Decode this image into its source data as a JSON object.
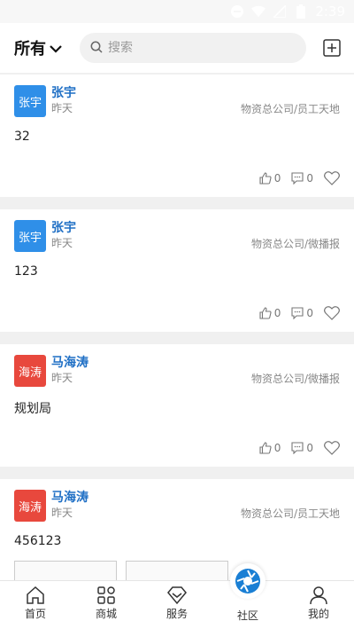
{
  "status_bar": {
    "time": "2:39"
  },
  "header": {
    "filter_label": "所有",
    "search_placeholder": "搜索"
  },
  "posts": [
    {
      "avatar_text": "张宇",
      "avatar_color": "#2f8fe8",
      "name": "张宇",
      "time": "昨天",
      "source": "物资总公司/员工天地",
      "content": "32",
      "likes": "0",
      "comments": "0"
    },
    {
      "avatar_text": "张宇",
      "avatar_color": "#2f8fe8",
      "name": "张宇",
      "time": "昨天",
      "source": "物资总公司/微播报",
      "content": "123",
      "likes": "0",
      "comments": "0"
    },
    {
      "avatar_text": "海涛",
      "avatar_color": "#e8483d",
      "name": "马海涛",
      "time": "昨天",
      "source": "物资总公司/微播报",
      "content": "规划局",
      "likes": "0",
      "comments": "0"
    },
    {
      "avatar_text": "海涛",
      "avatar_color": "#e8483d",
      "name": "马海涛",
      "time": "昨天",
      "source": "物资总公司/员工天地",
      "content": "456123"
    }
  ],
  "tabs": [
    {
      "label": "首页"
    },
    {
      "label": "商城"
    },
    {
      "label": "服务"
    },
    {
      "label": "社区"
    },
    {
      "label": "我的"
    }
  ],
  "colors": {
    "accent": "#1f6fc5",
    "fab": "#1a7fd4"
  }
}
